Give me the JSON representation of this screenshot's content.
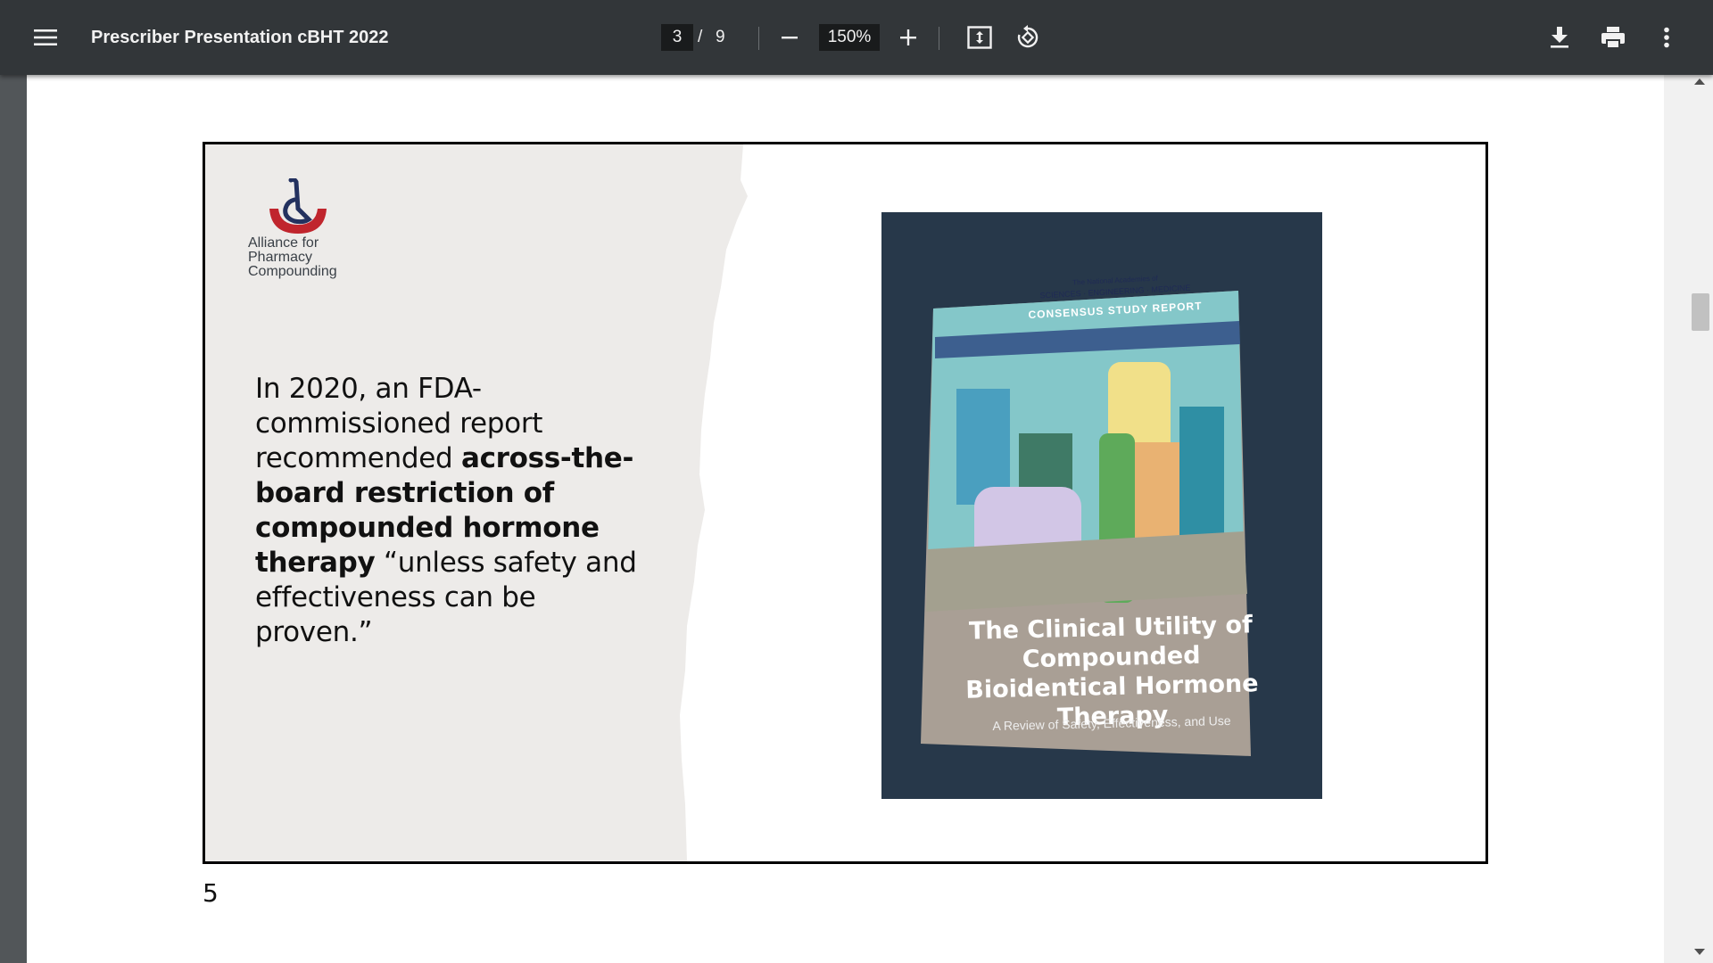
{
  "toolbar": {
    "menu_icon": "hamburger-menu-icon",
    "title": "Prescriber Presentation cBHT 2022",
    "current_page": "3",
    "page_separator": "/",
    "total_pages": "9",
    "zoom_out_icon": "minus-icon",
    "zoom_level": "150%",
    "zoom_in_icon": "plus-icon",
    "fit_icon": "fit-to-page-icon",
    "rotate_icon": "rotate-icon",
    "download_icon": "download-icon",
    "print_icon": "print-icon",
    "more_icon": "more-vert-icon",
    "background_color": "#323639"
  },
  "slide": {
    "logo_text": [
      "Alliance for",
      "Pharmacy",
      "Compounding"
    ],
    "text_intro": "In 2020, an FDA-commissioned report recommended ",
    "text_bold": "across-the-board restriction of compounded hormone therapy",
    "text_quote": " “unless safety and effectiveness can be proven.”",
    "book": {
      "header_line1": "The National Academies of",
      "header_line2": "SCIENCES · ENGINEERING · MEDICINE",
      "band_text": "CONSENSUS STUDY REPORT",
      "title": "The Clinical Utility of Compounded Bioidentical Hormone Therapy",
      "subtitle": "A Review of Safety, Effectiveness, and Use"
    }
  },
  "page_number": "5",
  "colors": {
    "viewer_background": "#525659",
    "page": "#ffffff",
    "slide_left_panel": "#edebe9",
    "logo_red": "#c0252d",
    "logo_navy": "#23315f"
  }
}
